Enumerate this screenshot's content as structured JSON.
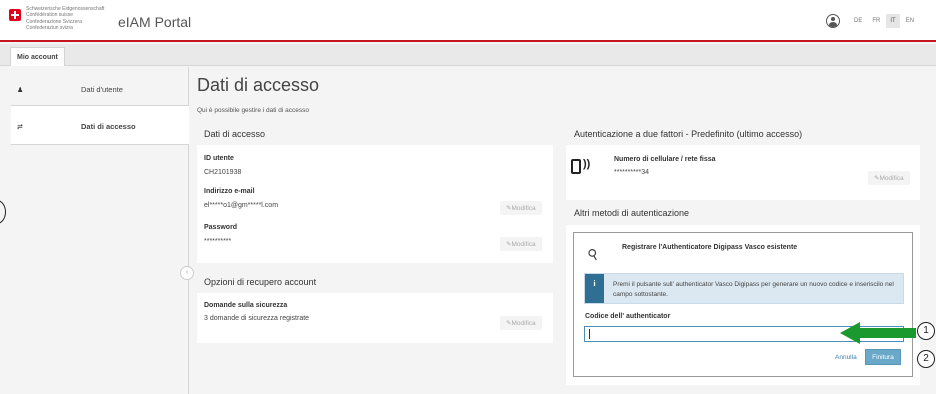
{
  "header": {
    "confederation_lines": [
      "Schweizerische Eidgenossenschaft",
      "Confédération suisse",
      "Confederazione Svizzera",
      "Confederaziun svizra"
    ],
    "portal_title": "eIAM Portal",
    "languages": [
      "DE",
      "FR",
      "IT",
      "EN"
    ],
    "active_language": "IT"
  },
  "tabs": {
    "account": "Mio account"
  },
  "sidebar": {
    "items": [
      {
        "label": "Dati d'utente",
        "icon": "user-icon"
      },
      {
        "label": "Dati di accesso",
        "icon": "key-icon"
      }
    ]
  },
  "page": {
    "title": "Dati di accesso",
    "subtitle": "Qui è possibile gestire i dati di accesso"
  },
  "access": {
    "heading": "Dati di accesso",
    "user_id_label": "ID utente",
    "user_id_value": "CH2101938",
    "email_label": "Indirizzo e-mail",
    "email_value": "el*****o1@gm*****l.com",
    "password_label": "Password",
    "password_value": "**********",
    "edit_label": "✎Modifica"
  },
  "recovery": {
    "heading": "Opzioni di recupero account",
    "questions_label": "Domande sulla sicurezza",
    "questions_value": "3 domande di sicurezza registrate",
    "edit_label": "✎Modifica"
  },
  "twofactor": {
    "heading": "Autenticazione a due fattori - Predefinito (ultimo accesso)",
    "phone_label": "Numero di cellulare / rete fissa",
    "phone_value": "**********34",
    "edit_label": "✎Modifica"
  },
  "other_methods": {
    "heading": "Altri metodi di autenticazione",
    "register_title": "Registrare l'Authenticatore Digipass Vasco esistente",
    "info_text": "Premi il pulsante sull' authenticator Vasco Digipass per generare un nuovo codice e inseriscilo nel campo sottostante.",
    "info_badge": "i",
    "code_label": "Codice dell' authenticator",
    "code_value": "",
    "cancel_label": "Annulla",
    "finish_label": "Finitura"
  },
  "annotations": {
    "step1": "1",
    "step2": "2"
  },
  "colors": {
    "accent_red": "#c4161c",
    "arrow_green": "#1a9a2e",
    "link_blue": "#3b7fb0"
  }
}
